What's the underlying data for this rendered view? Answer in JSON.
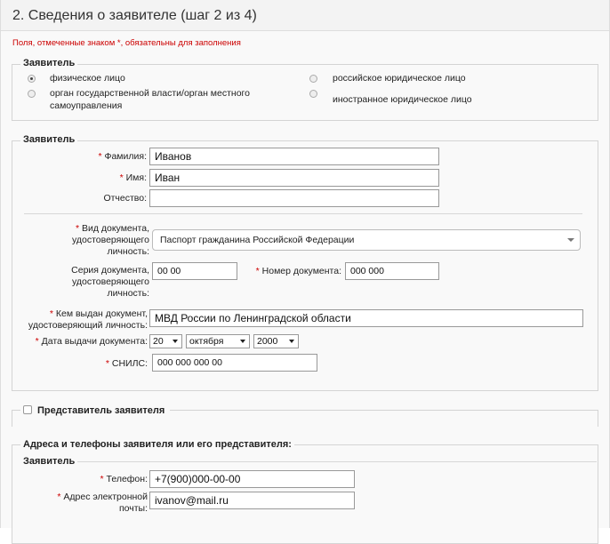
{
  "header": {
    "title": "2. Сведения о заявителе (шаг 2 из 4)"
  },
  "required_note": "Поля, отмеченные знаком *, обязательны для заполнения",
  "applicant_type": {
    "legend": "Заявитель",
    "options": [
      {
        "label": "физическое лицо",
        "selected": true
      },
      {
        "label": "российское юридическое лицо",
        "selected": false
      },
      {
        "label": "орган государственной власти/орган местного самоуправления",
        "selected": false
      },
      {
        "label": "иностранное юридическое лицо",
        "selected": false
      }
    ]
  },
  "applicant": {
    "legend": "Заявитель",
    "surname": {
      "label": "Фамилия:",
      "value": "Иванов"
    },
    "name": {
      "label": "Имя:",
      "value": "Иван"
    },
    "patronymic": {
      "label": "Отчество:",
      "value": ""
    },
    "doc_type": {
      "label": "Вид документа, удостоверяющего личность:",
      "value": "Паспорт гражданина Российской Федерации"
    },
    "doc_series": {
      "label": "Серия документа, удостоверяющего личность:",
      "value": "00 00"
    },
    "doc_number": {
      "label": "Номер документа:",
      "value": "000 000"
    },
    "issued_by": {
      "label": "Кем выдан документ, удостоверяющий личность:",
      "value": "МВД России по Ленинградской области"
    },
    "issue_date": {
      "label": "Дата выдачи документа:",
      "day": "20",
      "month": "октября",
      "year": "2000"
    },
    "snils": {
      "label": "СНИЛС:",
      "value": "000 000 000 00"
    }
  },
  "representative": {
    "label": "Представитель заявителя",
    "checked": false
  },
  "contacts": {
    "legend": "Адреса и телефоны заявителя или его представителя:",
    "sublegend": "Заявитель",
    "phone": {
      "label": "Телефон:",
      "value": "+7(900)000-00-00"
    },
    "email": {
      "label": "Адрес электронной почты:",
      "value": "ivanov@mail.ru"
    }
  },
  "required_mark": "*"
}
